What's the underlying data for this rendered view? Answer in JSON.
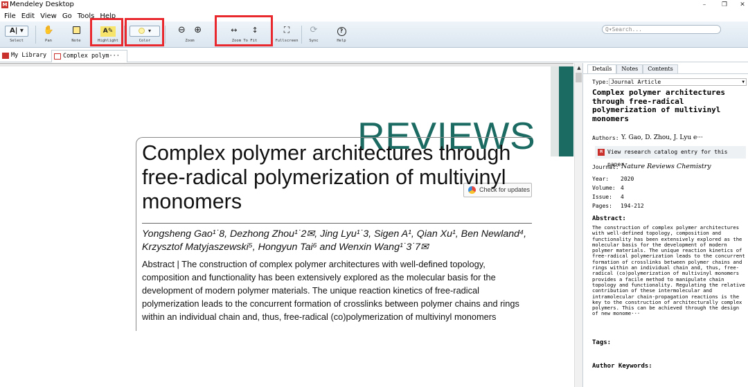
{
  "window": {
    "title": "Mendeley Desktop",
    "minimize": "–",
    "restore": "❐",
    "close": "✕"
  },
  "menu": [
    "File",
    "Edit",
    "View",
    "Go",
    "Tools",
    "Help"
  ],
  "toolbar": {
    "select_label": "Select",
    "pan_label": "Pan",
    "note_label": "Note",
    "highlight_label": "Highlight",
    "color_label": "Color",
    "zoom_label": "Zoom",
    "zoom_to_fit_label": "Zoom To Fit",
    "fullscreen_label": "Fullscreen",
    "sync_label": "Sync",
    "help_label": "Help",
    "search_placeholder": "Q▾Search..."
  },
  "tabs": [
    {
      "label": "My Library"
    },
    {
      "label": "Complex polym···"
    }
  ],
  "document": {
    "section_banner": "REVIEWS",
    "check_updates": "Check for updates",
    "title": "Complex polymer architectures through free-radical polymerization of multivinyl monomers",
    "authors": "Yongsheng Gao¹˙8, Dezhong Zhou¹˙2✉, Jing Lyu¹˙3, Sigen A¹, Qian Xu¹, Ben Newland⁴, Krzysztof Matyjaszewski⁵, Hongyun Tai⁶ and Wenxin Wang¹˙3˙7✉",
    "authors_line1": "Yongsheng Gao",
    "abstract": "Abstract | The construction of complex polymer architectures with well-defined topology, composition and functionality has been extensively explored as the molecular basis for the development of modern polymer materials. The unique reaction kinetics of free-radical polymerization leads to the concurrent formation of crosslinks between polymer chains and rings within an individual chain and, thus, free-radical (co)polymerization of multivinyl monomers"
  },
  "details": {
    "tabs": [
      "Details",
      "Notes",
      "Contents"
    ],
    "type_label": "Type:",
    "type_value": "Journal Article",
    "title": "Complex polymer architectures through free-radical polymerization of multivinyl monomers",
    "authors_label": "Authors:",
    "authors_value": "Y. Gao, D. Zhou, J. Lyu e···",
    "catalog_link": "View research catalog entry for this paper",
    "journal_label": "Journal:",
    "journal_value": "Nature Reviews Chemistry",
    "year_label": "Year:",
    "year_value": "2020",
    "volume_label": "Volume:",
    "volume_value": "4",
    "issue_label": "Issue:",
    "issue_value": "4",
    "pages_label": "Pages:",
    "pages_value": "194-212",
    "abstract_label": "Abstract:",
    "abstract_value": "The construction of complex polymer architectures with well-defined topology, composition and functionality has been extensively explored as the molecular basis for the development of modern polymer materials. The unique reaction kinetics of free-radical polymerization leads to the concurrent formation of crosslinks between polymer chains and rings within an individual chain and, thus, free-radical (co)polymerization of multivinyl monomers provides a facile method to manipulate chain topology and functionality. Regulating the relative contribution of these intermolecular and intramolecular chain-propagation reactions is the key to the construction of architecturally complex polymers. This can be achieved through the design of new monome···",
    "tags_label": "Tags:",
    "keywords_label": "Author Keywords:"
  },
  "colors": {
    "accent_teal": "#1b6b63",
    "highlight_red": "#e8282c",
    "toolbar_bg": "#dbe6f0"
  }
}
